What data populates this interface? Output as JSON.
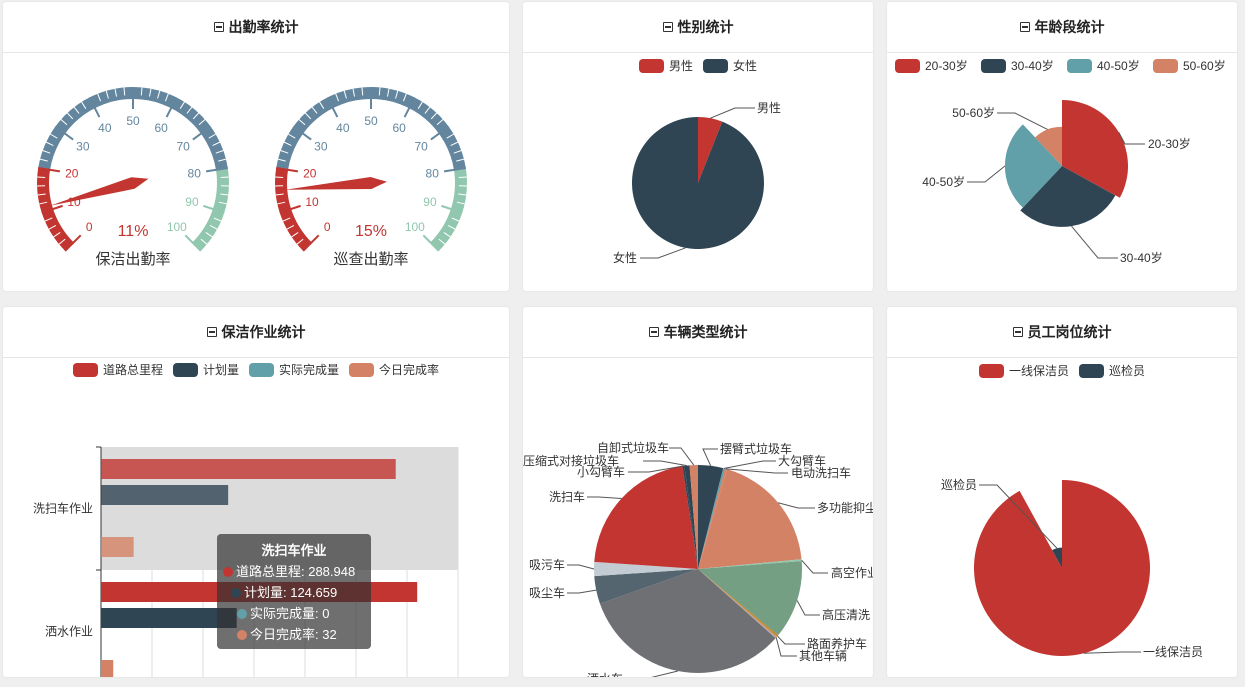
{
  "colors": {
    "red": "#c23531",
    "navy": "#2f4554",
    "teal": "#61a0a8",
    "orange": "#d48265",
    "green": "#91c7ae",
    "olive": "#749f83",
    "gray": "#6e7074",
    "steel": "#546570",
    "silver": "#c4ccd3",
    "gauge_blue": "#63869e"
  },
  "panels": {
    "attendance": {
      "title": "出勤率统计"
    },
    "gender": {
      "title": "性别统计"
    },
    "age": {
      "title": "年龄段统计"
    },
    "work": {
      "title": "保洁作业统计"
    },
    "vehicle": {
      "title": "车辆类型统计"
    },
    "post": {
      "title": "员工岗位统计"
    }
  },
  "tooltip": {
    "title": "洗扫车作业",
    "rows": [
      {
        "label": "道路总里程: 288.948",
        "color": "#c23531"
      },
      {
        "label": "计划量: 124.659",
        "color": "#2f4554"
      },
      {
        "label": "实际完成量: 0",
        "color": "#61a0a8"
      },
      {
        "label": "今日完成率: 32",
        "color": "#d48265"
      }
    ]
  },
  "chart_data": [
    {
      "id": "gauge-clean",
      "type": "gauge",
      "name": "保洁出勤率",
      "value": 11,
      "value_label": "11%",
      "min": 0,
      "max": 100,
      "tick_labels": [
        "0",
        "10",
        "20",
        "30",
        "40",
        "50",
        "60",
        "70",
        "80",
        "90",
        "100"
      ]
    },
    {
      "id": "gauge-patrol",
      "type": "gauge",
      "name": "巡查出勤率",
      "value": 15,
      "value_label": "15%",
      "min": 0,
      "max": 100,
      "tick_labels": [
        "0",
        "10",
        "20",
        "30",
        "40",
        "50",
        "60",
        "70",
        "80",
        "90",
        "100"
      ]
    },
    {
      "id": "gender",
      "type": "pie",
      "legend": [
        "男性",
        "女性"
      ],
      "slices": [
        {
          "name": "男性",
          "value": 6
        },
        {
          "name": "女性",
          "value": 94
        }
      ]
    },
    {
      "id": "age",
      "type": "pie",
      "rose": true,
      "legend": [
        "20-30岁",
        "30-40岁",
        "40-50岁",
        "50-60岁"
      ],
      "slices": [
        {
          "name": "20-30岁",
          "value": 33
        },
        {
          "name": "30-40岁",
          "value": 29
        },
        {
          "name": "40-50岁",
          "value": 26
        },
        {
          "name": "50-60岁",
          "value": 12
        }
      ]
    },
    {
      "id": "work",
      "type": "bar",
      "orientation": "horizontal",
      "legend": [
        "道路总里程",
        "计划量",
        "实际完成量",
        "今日完成率"
      ],
      "categories": [
        "洗扫车作业",
        "洒水作业"
      ],
      "series": [
        {
          "name": "道路总里程",
          "values": [
            288.948,
            310
          ]
        },
        {
          "name": "计划量",
          "values": [
            124.659,
            133
          ]
        },
        {
          "name": "实际完成量",
          "values": [
            0,
            0
          ]
        },
        {
          "name": "今日完成率",
          "values": [
            32,
            12
          ]
        }
      ],
      "xlim": [
        0,
        350
      ],
      "xticks": [
        "0",
        "50",
        "100",
        "150",
        "200",
        "250",
        "300",
        "350"
      ]
    },
    {
      "id": "vehicle",
      "type": "pie",
      "slices": [
        {
          "name": "摆臂式垃圾车",
          "value": 3.9
        },
        {
          "name": "大勾臂车",
          "value": 0.3
        },
        {
          "name": "电动洗扫车",
          "value": 0.3
        },
        {
          "name": "多功能抑尘",
          "value": 19
        },
        {
          "name": "高空作业",
          "value": 0.3
        },
        {
          "name": "高压清洗",
          "value": 12.2
        },
        {
          "name": "路面养护车",
          "value": 0.3
        },
        {
          "name": "其他车辆",
          "value": 0.3
        },
        {
          "name": "洒水车",
          "value": 33
        },
        {
          "name": "吸尘车",
          "value": 4.3
        },
        {
          "name": "吸污车",
          "value": 2.2
        },
        {
          "name": "洗扫车",
          "value": 21.5
        },
        {
          "name": "小勾臂车",
          "value": 0.3
        },
        {
          "name": "压缩式对接垃圾车",
          "value": 0.8
        },
        {
          "name": "自卸式垃圾车",
          "value": 1.3
        }
      ]
    },
    {
      "id": "post",
      "type": "pie",
      "rose": true,
      "legend": [
        "一线保洁员",
        "巡检员"
      ],
      "slices": [
        {
          "name": "一线保洁员",
          "value": 92
        },
        {
          "name": "巡检员",
          "value": 8
        }
      ]
    }
  ]
}
